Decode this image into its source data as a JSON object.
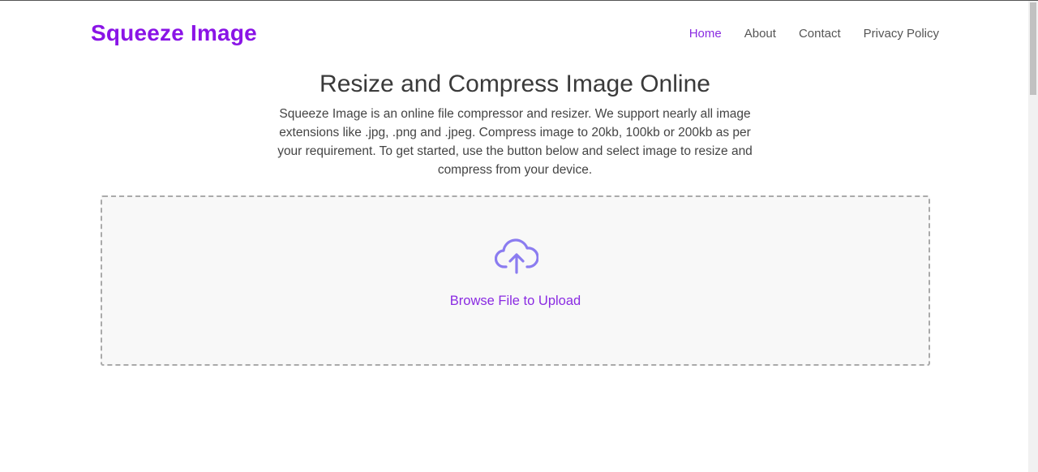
{
  "header": {
    "logo": "Squeeze Image",
    "nav": [
      {
        "label": "Home",
        "active": true
      },
      {
        "label": "About",
        "active": false
      },
      {
        "label": "Contact",
        "active": false
      },
      {
        "label": "Privacy Policy",
        "active": false
      }
    ]
  },
  "main": {
    "title": "Resize and Compress Image Online",
    "description": "Squeeze Image is an online file compressor and resizer. We support nearly all image extensions like .jpg, .png and .jpeg. Compress image to 20kb, 100kb or 200kb as per your requirement. To get started, use the button below and select image to resize and compress from your device.",
    "upload": {
      "icon": "cloud-upload-icon",
      "label": "Browse File to Upload"
    }
  },
  "colors": {
    "brand": "#8a14e6",
    "accent": "#8a2be2",
    "icon": "#8b7cf0"
  }
}
